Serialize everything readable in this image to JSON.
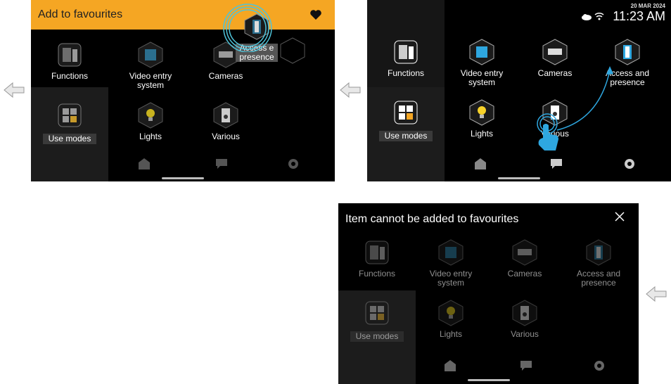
{
  "screen1": {
    "header_title": "Add to favourites",
    "heart_icon": "heart-icon",
    "access_label": "Access e presence"
  },
  "screen2": {
    "date": "20 MAR 2024",
    "time": "11:23 AM"
  },
  "screen3": {
    "header_title": "Item cannot be added to favourites",
    "close_icon": "close-icon"
  },
  "items": {
    "functions": "Functions",
    "video": "Video entry system",
    "cameras": "Cameras",
    "access": "Access and presence",
    "use_modes": "Use modes",
    "lights": "Lights",
    "various": "Various"
  },
  "colors": {
    "orange": "#f5a623",
    "accent_blue": "#2ea7e0"
  }
}
